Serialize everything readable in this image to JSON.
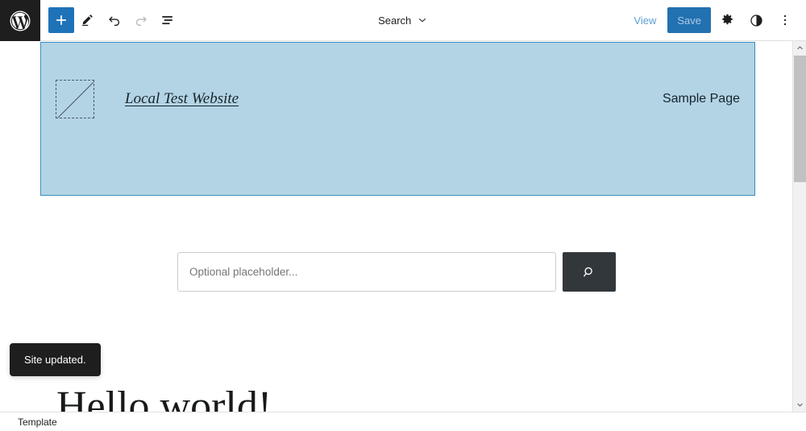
{
  "app": {
    "name": "WordPress Site Editor",
    "logo_icon": "wordpress-logo-icon"
  },
  "header": {
    "left_tools": [
      {
        "name": "add-block-button",
        "icon": "plus-icon",
        "label": "Add block",
        "state": "primary"
      },
      {
        "name": "edit-tool-button",
        "icon": "pencil-icon",
        "label": "Tools",
        "state": "normal"
      },
      {
        "name": "undo-button",
        "icon": "undo-icon",
        "label": "Undo",
        "state": "normal"
      },
      {
        "name": "redo-button",
        "icon": "redo-icon",
        "label": "Redo",
        "state": "disabled"
      },
      {
        "name": "list-view-button",
        "icon": "list-view-icon",
        "label": "Document Overview",
        "state": "normal"
      }
    ],
    "document_title": "Search",
    "document_chevron_icon": "chevron-down-icon",
    "view_label": "View",
    "save_label": "Save",
    "save_disabled": true,
    "right_tools": [
      {
        "name": "settings-button",
        "icon": "gear-icon",
        "label": "Settings"
      },
      {
        "name": "styles-button",
        "icon": "contrast-icon",
        "label": "Styles"
      },
      {
        "name": "options-button",
        "icon": "more-vertical-icon",
        "label": "Options"
      }
    ]
  },
  "canvas": {
    "site_header_block": {
      "logo_placeholder_name": "site-logo-placeholder",
      "site_title": "Local Test Website",
      "nav_items": [
        "Sample Page"
      ],
      "background_color": "#b3d4e5",
      "selected_border_color": "#3a8fc0"
    },
    "search_block": {
      "input_value": "",
      "input_placeholder": "Optional placeholder...",
      "button_icon": "search-icon",
      "button_color": "#32373c"
    },
    "post_title": "Hello world!"
  },
  "scrollbar": {
    "up_arrow_icon": "chevron-up-icon",
    "down_arrow_icon": "chevron-down-icon",
    "thumb_name": "scrollbar-thumb"
  },
  "snackbar": {
    "message": "Site updated."
  },
  "footer": {
    "breadcrumb": [
      "Template"
    ]
  }
}
